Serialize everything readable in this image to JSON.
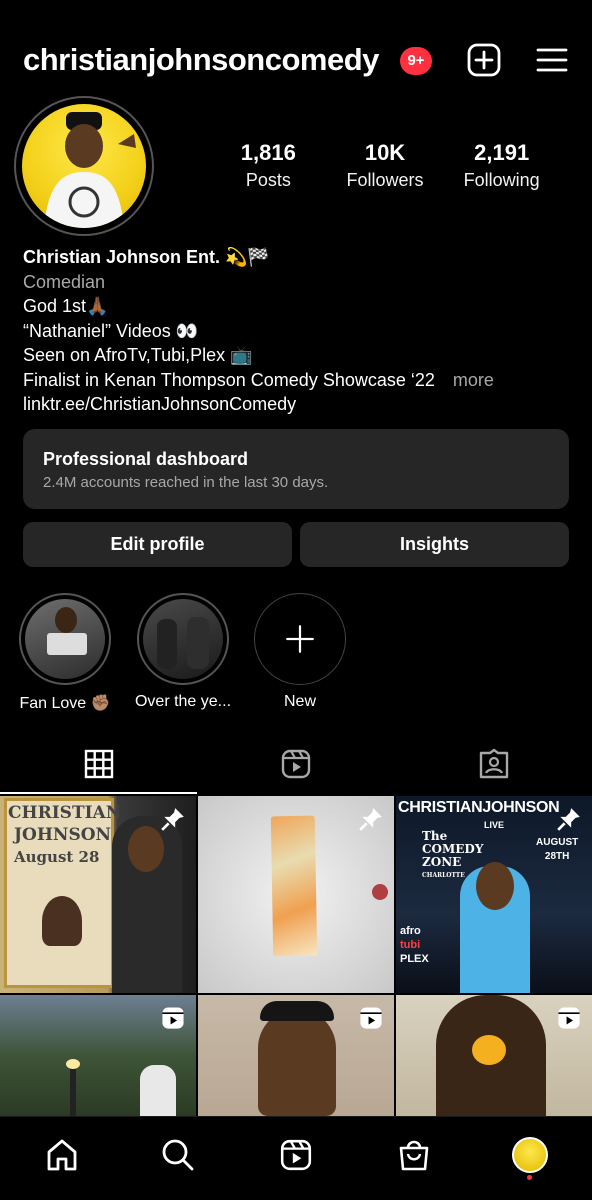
{
  "header": {
    "username": "christianjohnsoncomedy",
    "notification_badge": "9+",
    "add_icon": "plus-square-icon",
    "menu_icon": "hamburger-menu-icon"
  },
  "profile": {
    "stats": [
      {
        "value": "1,816",
        "label": "Posts"
      },
      {
        "value": "10K",
        "label": "Followers"
      },
      {
        "value": "2,191",
        "label": "Following"
      }
    ],
    "display_name": "Christian Johnson Ent. 💫🏁",
    "category": "Comedian",
    "bio_lines": [
      "God 1st🙏🏾",
      "“Nathaniel” Videos 👀",
      "Seen on AfroTv,Tubi,Plex 📺",
      "Finalist in Kenan Thompson Comedy Showcase ‘22"
    ],
    "more_label": "more",
    "link": "linktr.ee/ChristianJohnsonComedy"
  },
  "dashboard": {
    "title": "Professional dashboard",
    "subtitle": "2.4M accounts reached in the last 30 days."
  },
  "buttons": {
    "edit_profile": "Edit profile",
    "insights": "Insights"
  },
  "highlights": [
    {
      "label": "Fan Love ✊🏽"
    },
    {
      "label": "Over the ye..."
    },
    {
      "label": "New"
    }
  ],
  "tabs": [
    {
      "icon": "grid-icon",
      "active": true
    },
    {
      "icon": "reels-icon",
      "active": false
    },
    {
      "icon": "tagged-icon",
      "active": false
    }
  ],
  "posts": [
    {
      "overlay_text": [
        "CHRISTIAN",
        "JOHNSON",
        "August 28"
      ],
      "icon": "pin-icon"
    },
    {
      "overlay_text": [],
      "icon": "pin-icon"
    },
    {
      "overlay_text": [
        "CHRISTIANJOHNSON",
        "LIVE",
        "The",
        "COMEDY",
        "ZONE",
        "CHARLOTTE",
        "AUGUST",
        "28TH",
        "afro",
        "tubi",
        "PLEX"
      ],
      "icon": "pin-icon"
    },
    {
      "overlay_text": [],
      "icon": "reels-icon"
    },
    {
      "overlay_text": [],
      "icon": "reels-icon"
    },
    {
      "overlay_text": [],
      "icon": "reels-icon"
    }
  ],
  "colors": {
    "background": "#000000",
    "surface": "#262626",
    "badge": "#ff3040",
    "muted_text": "#a8a8a8",
    "avatar_yellow": "#f4d21c"
  },
  "bottom_nav": [
    {
      "icon": "home-icon"
    },
    {
      "icon": "search-icon"
    },
    {
      "icon": "reels-icon"
    },
    {
      "icon": "shop-icon"
    },
    {
      "icon": "profile-avatar-icon"
    }
  ]
}
